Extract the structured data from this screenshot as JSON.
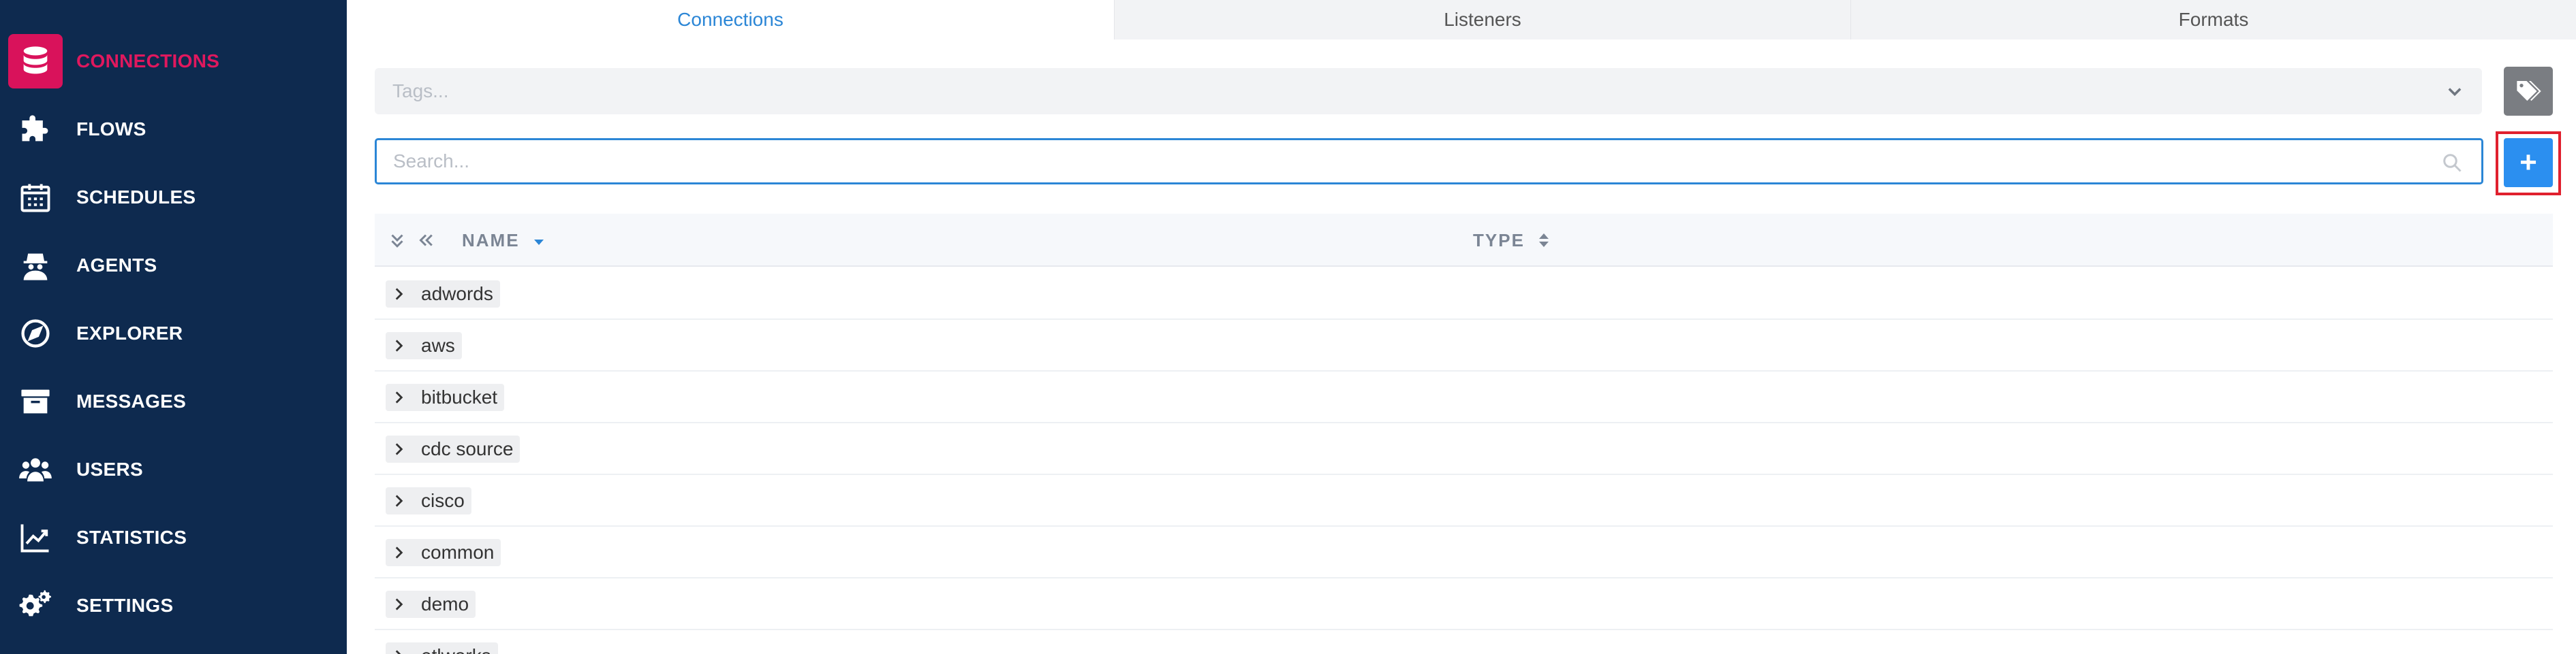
{
  "sidebar": {
    "items": [
      {
        "label": "CONNECTIONS",
        "icon": "database-icon",
        "active": true
      },
      {
        "label": "FLOWS",
        "icon": "puzzle-icon"
      },
      {
        "label": "SCHEDULES",
        "icon": "calendar-icon"
      },
      {
        "label": "AGENTS",
        "icon": "agent-icon"
      },
      {
        "label": "EXPLORER",
        "icon": "compass-icon"
      },
      {
        "label": "MESSAGES",
        "icon": "archive-icon"
      },
      {
        "label": "USERS",
        "icon": "users-icon"
      },
      {
        "label": "STATISTICS",
        "icon": "chart-line-icon"
      },
      {
        "label": "SETTINGS",
        "icon": "gears-icon"
      }
    ],
    "active_color": "#d9125b",
    "background": "#0e2a4f"
  },
  "tabs": [
    {
      "label": "Connections",
      "active": true
    },
    {
      "label": "Listeners"
    },
    {
      "label": "Formats"
    }
  ],
  "tags": {
    "placeholder": "Tags...",
    "button_icon": "tag-icon"
  },
  "search": {
    "placeholder": "Search...",
    "value": "",
    "icon": "search-icon"
  },
  "add_button": {
    "label": "+",
    "icon": "plus-icon"
  },
  "table": {
    "columns": {
      "name": "NAME",
      "type": "TYPE"
    },
    "header_icons": [
      "expand-all-icon",
      "collapse-all-icon"
    ],
    "rows": [
      "adwords",
      "aws",
      "bitbucket",
      "cdc source",
      "cisco",
      "common",
      "demo",
      "etlworks"
    ]
  },
  "colors": {
    "accent": "#2b86d6",
    "highlight": "#e0202e"
  }
}
